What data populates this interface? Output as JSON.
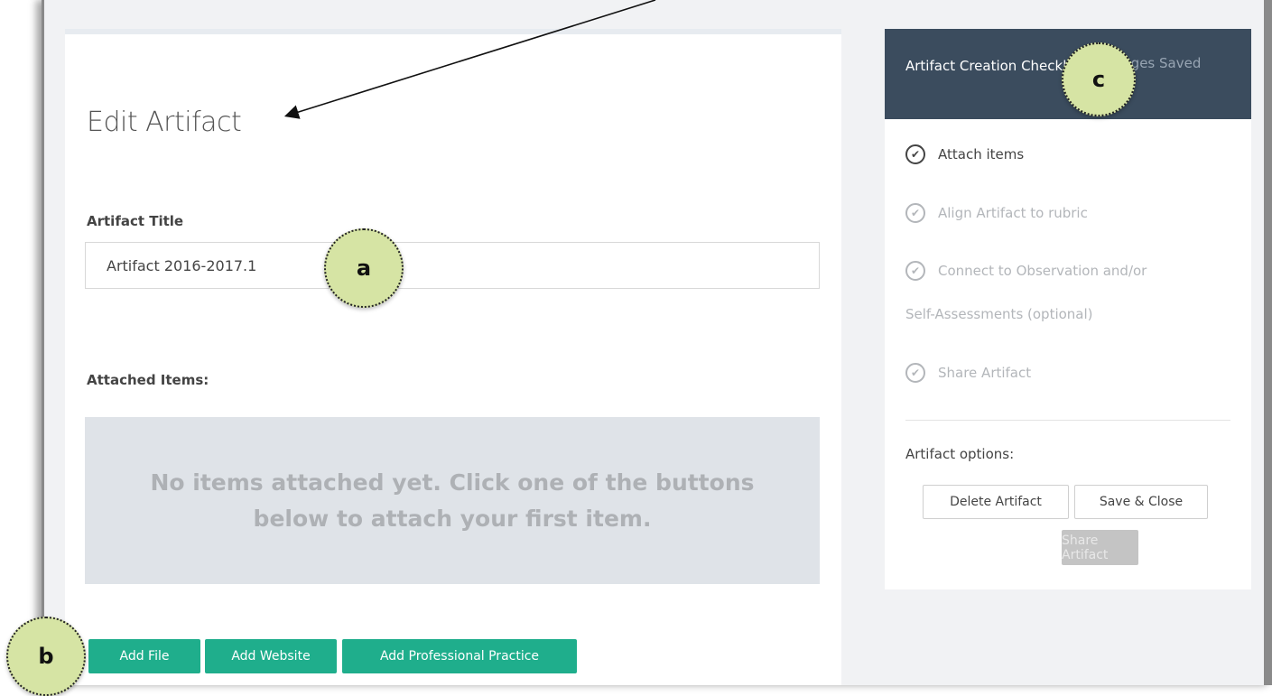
{
  "main": {
    "page_title": "Edit Artifact",
    "title_label": "Artifact Title",
    "title_value": "Artifact 2016-2017.1",
    "attached_label": "Attached Items:",
    "empty_message": "No items attached yet. Click one of the buttons below to attach your first item.",
    "buttons": {
      "add_file": "Add File",
      "add_website": "Add Website",
      "add_professional_practice": "Add Professional Practice"
    }
  },
  "sidebar": {
    "title": "Artifact Creation Checklist",
    "status": "Changes Saved",
    "checklist": [
      {
        "label": "Attach items",
        "state": "done"
      },
      {
        "label": "Align Artifact to rubric",
        "state": "pending"
      },
      {
        "label": "Connect to Observation and/or",
        "state": "pending"
      },
      {
        "label": "Self-Assessments (optional)",
        "state": "pending"
      },
      {
        "label": "Share Artifact",
        "state": "pending"
      }
    ],
    "options_label": "Artifact options:",
    "buttons": {
      "delete": "Delete Artifact",
      "save_close": "Save & Close",
      "share": "Share Artifact"
    }
  },
  "callouts": {
    "a": "a",
    "b": "b",
    "c": "c"
  },
  "colors": {
    "accent_green": "#1fae8c",
    "header_slate": "#3b4c5e",
    "callout_fill": "#d6e4a4"
  }
}
